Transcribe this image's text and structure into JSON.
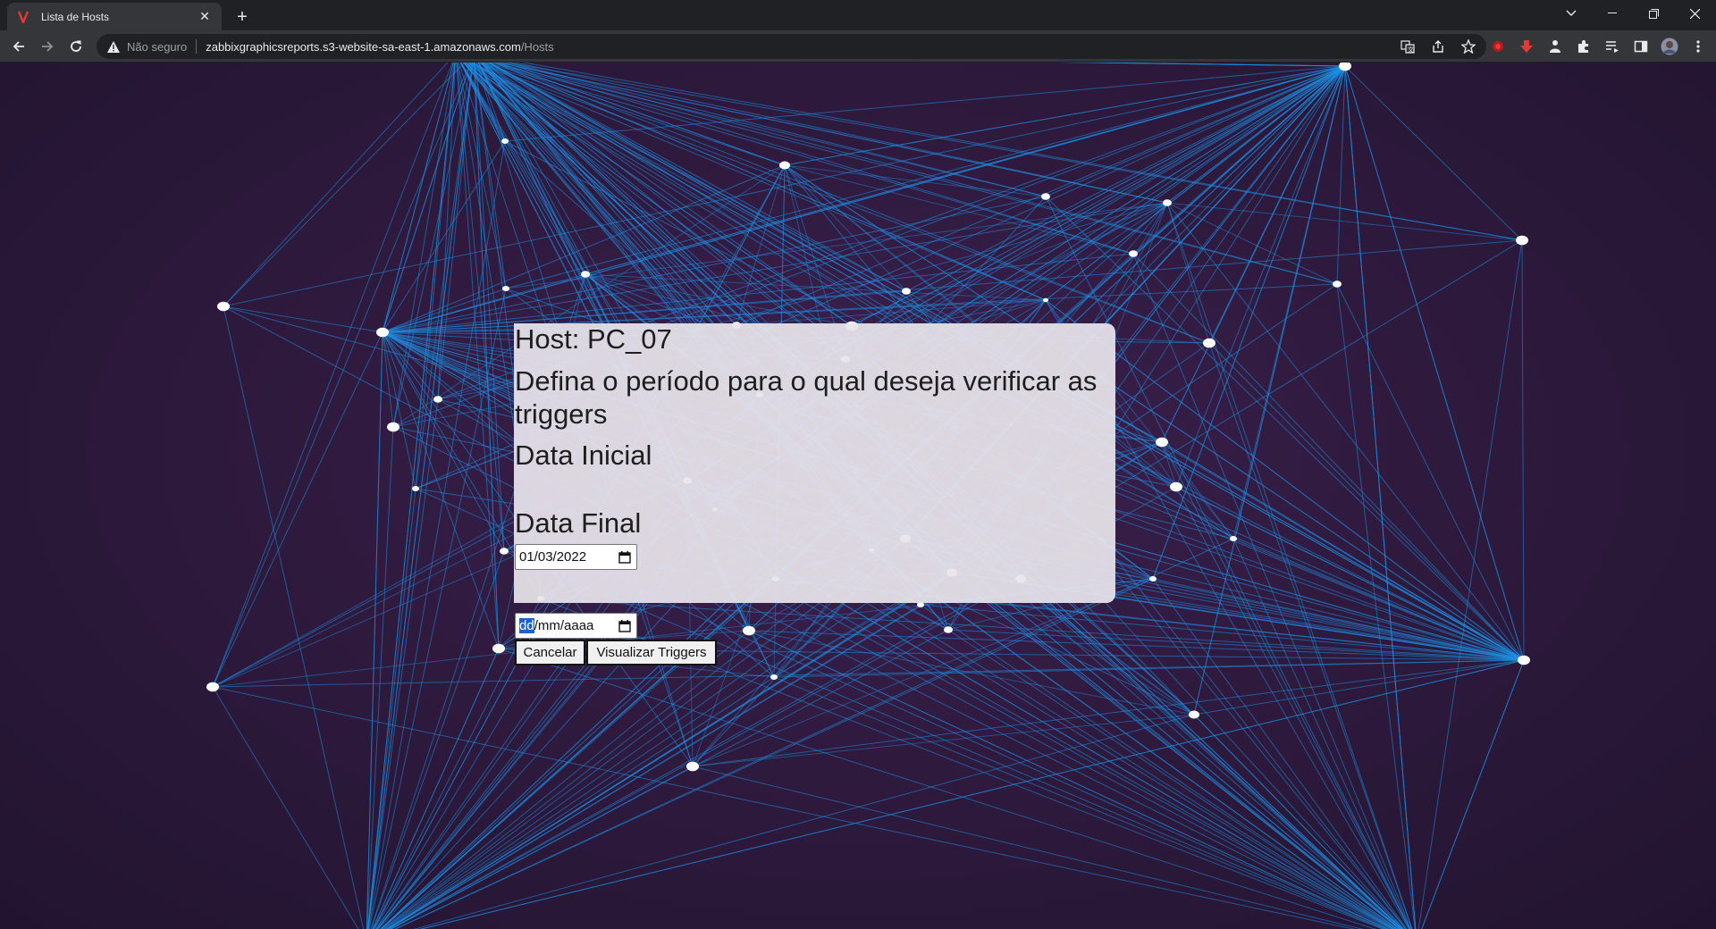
{
  "browser": {
    "tab_title": "Lista de Hosts",
    "security_label": "Não seguro",
    "url_host": "zabbixgraphicsreports.s3-website-sa-east-1.amazonaws.com",
    "url_path": "/Hosts",
    "accent_color": "#c62828"
  },
  "page": {
    "host_title": "Host: PC_07",
    "instruction": "Defina o período para o qual deseja verificar as triggers",
    "start_label": "Data Inicial",
    "start_value": "01/03/2022",
    "end_label": "Data Final",
    "end_placeholder_day": "dd",
    "end_placeholder_rest": "/mm/aaaa",
    "cancel_label": "Cancelar",
    "view_label": "Visualizar Triggers"
  },
  "colors": {
    "background": "#2f1a3e",
    "network_line": "#1e8fe6",
    "network_node": "#ffffff",
    "panel": "#e8e4eb"
  }
}
